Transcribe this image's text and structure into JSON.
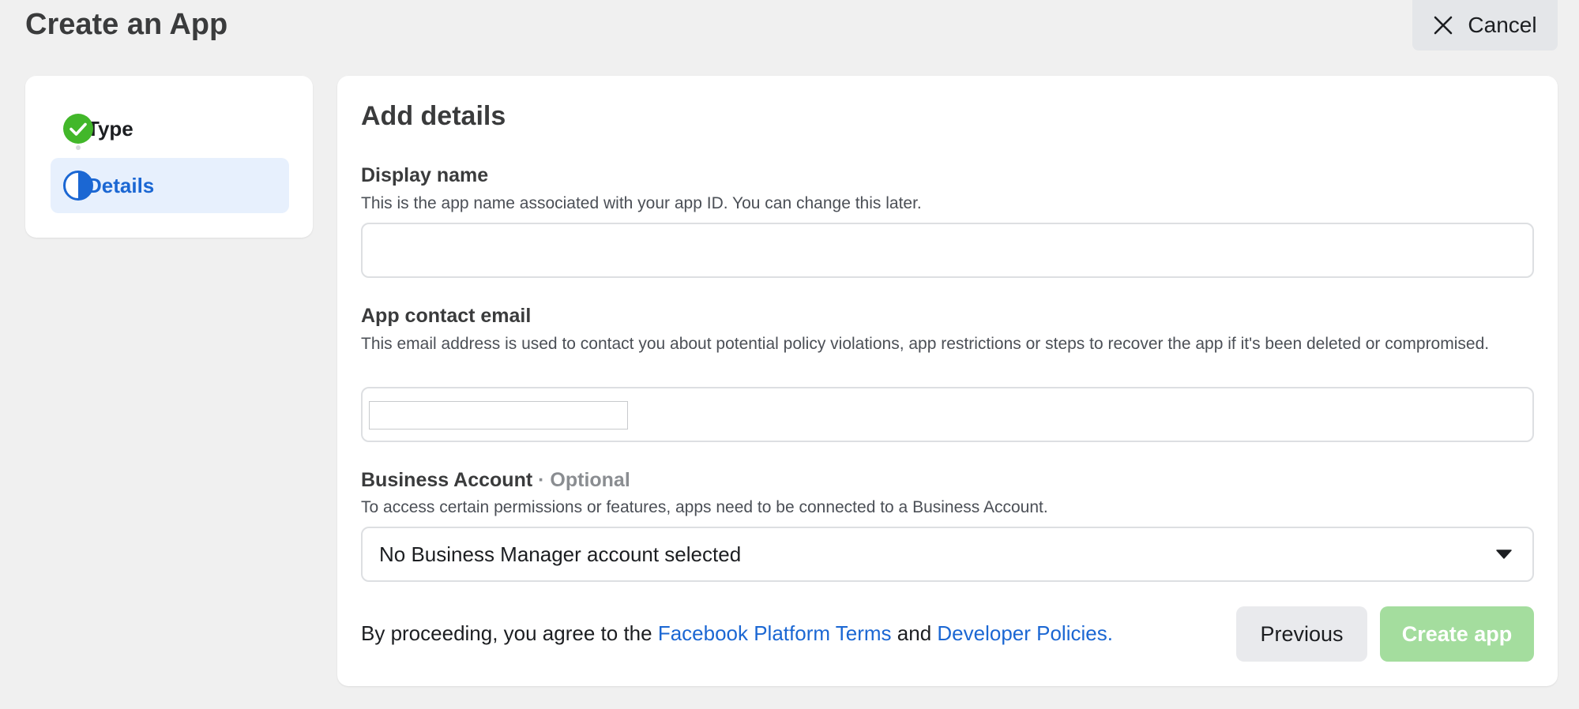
{
  "header": {
    "title": "Create an App",
    "cancel_label": "Cancel"
  },
  "steps": [
    {
      "label": "Type",
      "status": "complete"
    },
    {
      "label": "Details",
      "status": "current"
    }
  ],
  "form": {
    "title": "Add details",
    "display_name": {
      "label": "Display name",
      "help": "This is the app name associated with your app ID. You can change this later.",
      "value": ""
    },
    "contact_email": {
      "label": "App contact email",
      "help": "This email address is used to contact you about potential policy violations, app restrictions or steps to recover the app if it's been deleted or compromised.",
      "value": ""
    },
    "business_account": {
      "label": "Business Account",
      "optional": " · Optional",
      "help": "To access certain permissions or features, apps need to be connected to a Business Account.",
      "selected": "No Business Manager account selected"
    }
  },
  "footer": {
    "terms_prefix": "By proceeding, you agree to the ",
    "terms_link": "Facebook Platform Terms",
    "terms_middle": " and ",
    "policies_link": "Developer Policies.",
    "previous_label": "Previous",
    "create_label": "Create app"
  },
  "colors": {
    "accent": "#1b67d3",
    "success": "#42b72a",
    "create_disabled": "#a4dd9e"
  },
  "icons": {
    "cancel": "close-icon",
    "type_step": "check-circle-icon",
    "details_step": "half-circle-icon",
    "select": "caret-down-icon"
  }
}
